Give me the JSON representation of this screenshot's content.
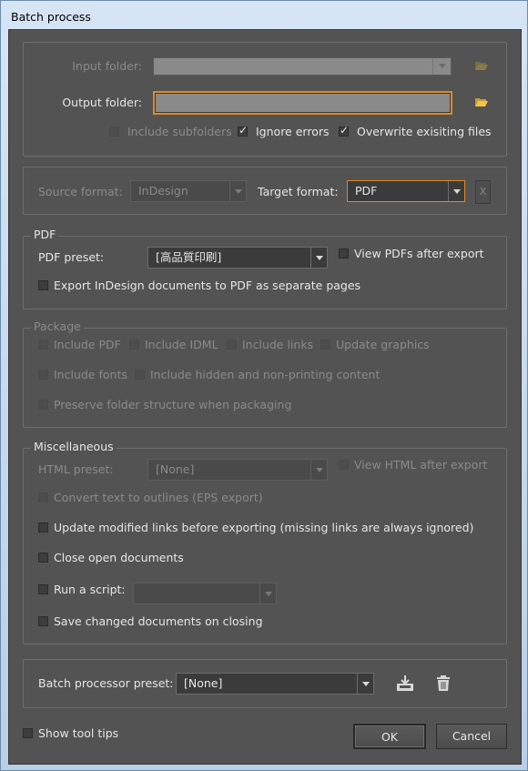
{
  "window": {
    "title": "Batch process"
  },
  "folders": {
    "input_label": "Input folder:",
    "input_value": "",
    "output_label": "Output folder:",
    "output_value": "",
    "include_subfolders": "Include subfolders",
    "ignore_errors": "Ignore errors",
    "overwrite": "Overwrite exisiting files"
  },
  "formats": {
    "source_label": "Source format:",
    "source_value": "InDesign",
    "target_label": "Target format:",
    "target_value": "PDF",
    "clear": "X"
  },
  "pdf": {
    "legend": "PDF",
    "preset_label": "PDF preset:",
    "preset_value": "[高品質印刷]",
    "view_after": "View PDFs after export",
    "separate_pages": "Export InDesign documents to PDF as separate pages"
  },
  "package": {
    "legend": "Package",
    "include_pdf": "Include PDF",
    "include_idml": "Include IDML",
    "include_links": "Include links",
    "update_graphics": "Update graphics",
    "include_fonts": "Include fonts",
    "include_hidden": "Include hidden and non-printing content",
    "preserve": "Preserve folder structure when packaging"
  },
  "misc": {
    "legend": "Miscellaneous",
    "html_label": "HTML preset:",
    "html_value": "[None]",
    "view_html": "View HTML after export",
    "convert_outlines": "Convert text to outlines (EPS export)",
    "update_links": "Update modified links before exporting (missing links are always ignored)",
    "close_docs": "Close open documents",
    "run_script": "Run a script:",
    "script_value": "",
    "save_changed": "Save changed documents on closing"
  },
  "preset": {
    "label": "Batch processor preset:",
    "value": "[None]"
  },
  "footer": {
    "tooltips": "Show tool tips",
    "ok": "OK",
    "cancel": "Cancel"
  }
}
